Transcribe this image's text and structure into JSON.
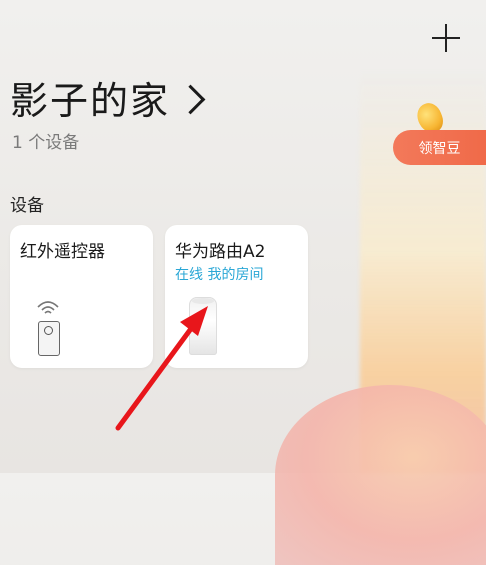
{
  "header": {
    "add_icon": "plus-icon"
  },
  "home": {
    "title": "影子的家",
    "device_count": "1 个设备"
  },
  "reward": {
    "label": "领智豆",
    "icon": "bean-icon"
  },
  "section": {
    "label": "设备"
  },
  "devices": [
    {
      "name": "红外遥控器",
      "status": "",
      "icon": "remote-control-icon"
    },
    {
      "name": "华为路由A2",
      "status": "在线 我的房间",
      "icon": "router-icon"
    }
  ],
  "colors": {
    "accent": "#f06a49",
    "status_online": "#2aa7d6",
    "annotation_arrow": "#e8161b"
  }
}
